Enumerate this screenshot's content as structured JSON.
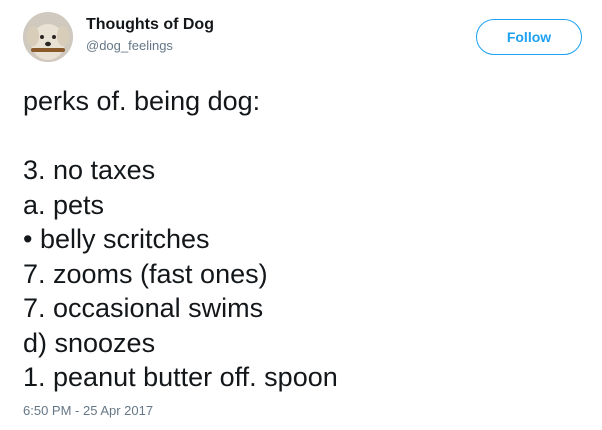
{
  "user": {
    "display_name": "Thoughts of Dog",
    "handle": "@dog_feelings",
    "avatar": "dog-avatar"
  },
  "follow_button": {
    "label": "Follow"
  },
  "tweet": {
    "heading": "perks of. being dog:",
    "lines": [
      "3. no taxes",
      "a. pets",
      "• belly scritches",
      "7. zooms (fast ones)",
      "7. occasional swims",
      "d) snoozes",
      "1. peanut butter off. spoon"
    ],
    "timestamp": "6:50 PM - 25 Apr 2017"
  },
  "colors": {
    "accent": "#1da1f2",
    "text": "#14171a",
    "secondary_text": "#657786"
  }
}
